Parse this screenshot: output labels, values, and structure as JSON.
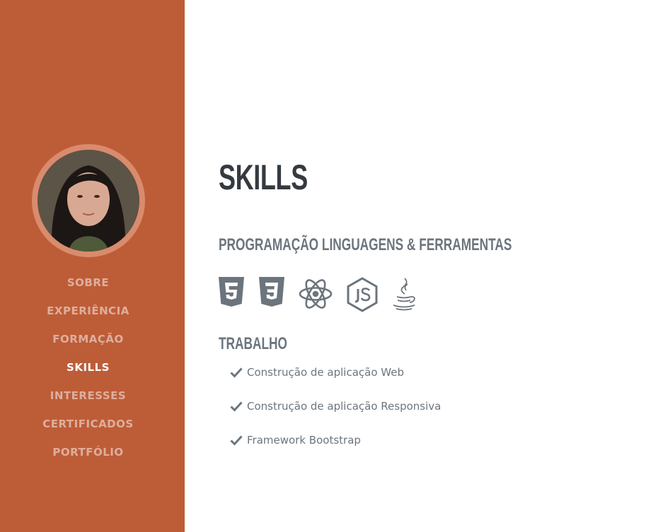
{
  "sidebar": {
    "nav": [
      {
        "label": "SOBRE",
        "active": false
      },
      {
        "label": "EXPERIÊNCIA",
        "active": false
      },
      {
        "label": "FORMAÇÃO",
        "active": false
      },
      {
        "label": "SKILLS",
        "active": true
      },
      {
        "label": "INTERESSES",
        "active": false
      },
      {
        "label": "CERTIFICADOS",
        "active": false
      },
      {
        "label": "PORTFÓLIO",
        "active": false
      }
    ]
  },
  "main": {
    "title": "SKILLS",
    "languages_heading": "PROGRAMAÇÃO LINGUAGENS & FERRAMENTAS",
    "tools": [
      {
        "icon": "html5-icon"
      },
      {
        "icon": "css3-icon"
      },
      {
        "icon": "react-icon"
      },
      {
        "icon": "nodejs-icon"
      },
      {
        "icon": "java-icon"
      }
    ],
    "work_heading": "TRABALHO",
    "work_items": [
      "Construção de aplicação Web",
      "Construção de aplicação Responsiva",
      "Framework Bootstrap"
    ]
  },
  "colors": {
    "sidebar_bg": "#bd5d38",
    "heading": "#343a40",
    "muted": "#6c757d"
  }
}
